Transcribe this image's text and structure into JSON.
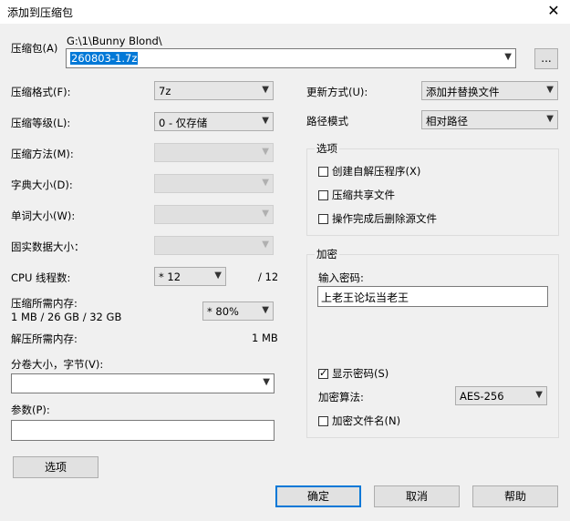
{
  "window": {
    "title": "添加到压缩包",
    "close_glyph": "✕"
  },
  "archive": {
    "label": "压缩包(A)",
    "path": "G:\\1\\Bunny Blond\\",
    "name": "260803-1.7z",
    "browse_label": "..."
  },
  "left": {
    "format": {
      "label": "压缩格式(F):",
      "value": "7z"
    },
    "level": {
      "label": "压缩等级(L):",
      "value": "0 - 仅存储"
    },
    "method": {
      "label": "压缩方法(M):",
      "value": ""
    },
    "dict": {
      "label": "字典大小(D):",
      "value": ""
    },
    "word": {
      "label": "单词大小(W):",
      "value": ""
    },
    "solid": {
      "label": "固实数据大小：",
      "value": ""
    },
    "cpu": {
      "label": "CPU 线程数:",
      "value": "* 12",
      "max": "/ 12"
    },
    "mem_compress": {
      "label": "压缩所需内存:",
      "detail": "1 MB / 26 GB / 32 GB",
      "value": "* 80%"
    },
    "mem_decompress": {
      "label": "解压所需内存:",
      "value": "1 MB"
    },
    "volume": {
      "label": "分卷大小，字节(V):",
      "value": ""
    },
    "params": {
      "label": "参数(P):",
      "value": ""
    },
    "options_button": "选项"
  },
  "right": {
    "update": {
      "label": "更新方式(U):",
      "value": "添加并替换文件"
    },
    "pathmode": {
      "label": "路径模式",
      "value": "相对路径"
    },
    "options_group": {
      "title": "选项",
      "items": [
        {
          "label": "创建自解压程序(X)",
          "checked": false
        },
        {
          "label": "压缩共享文件",
          "checked": false
        },
        {
          "label": "操作完成后删除源文件",
          "checked": false
        }
      ]
    },
    "encryption": {
      "title": "加密",
      "password_label": "输入密码:",
      "password": "上老王论坛当老王",
      "show_password": {
        "label": "显示密码(S)",
        "checked": true
      },
      "algo_label": "加密算法:",
      "algo_value": "AES-256",
      "encrypt_names": {
        "label": "加密文件名(N)",
        "checked": false
      }
    }
  },
  "buttons": {
    "ok": "确定",
    "cancel": "取消",
    "help": "帮助"
  },
  "icons": {
    "dropdown": "chevron-down-icon",
    "close": "close-icon"
  }
}
